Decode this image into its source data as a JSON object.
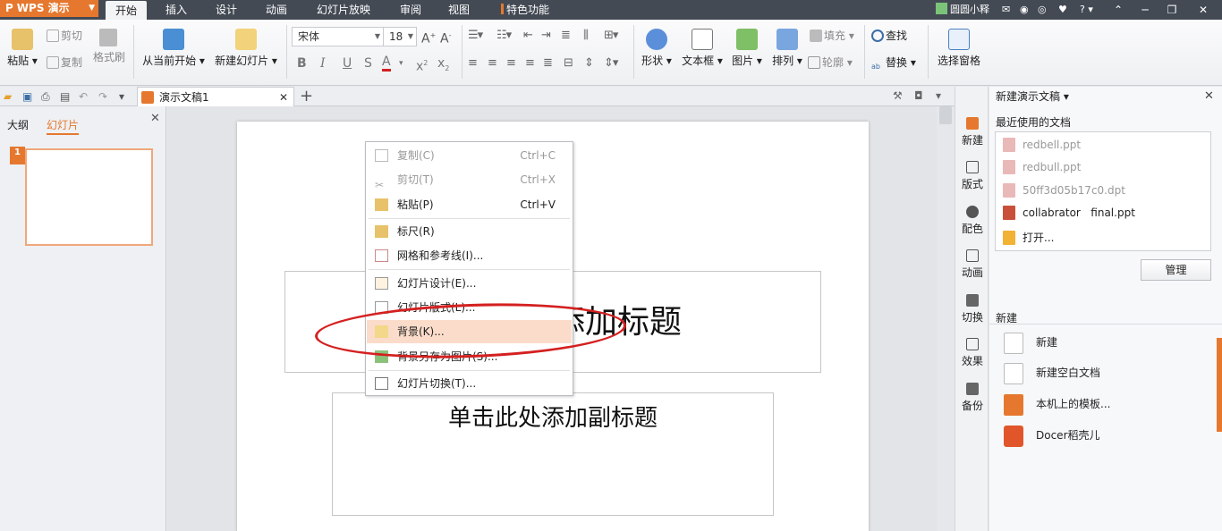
{
  "app": {
    "name": "WPS 演示"
  },
  "menu": {
    "tabs": [
      "开始",
      "插入",
      "设计",
      "动画",
      "幻灯片放映",
      "审阅",
      "视图",
      "特色功能"
    ]
  },
  "user": {
    "name": "圆圆小释",
    "help": "?"
  },
  "ribbon": {
    "paste": "粘贴",
    "cut": "剪切",
    "copy": "复制",
    "format_painter": "格式刷",
    "from_current": "从当前开始",
    "new_slide": "新建幻灯片",
    "font_name": "宋体",
    "font_size": "18",
    "shape": "形状",
    "textbox": "文本框",
    "picture": "图片",
    "arrange": "排列",
    "fill": "填充",
    "outline": "轮廓",
    "find": "查找",
    "replace": "替换",
    "selection_pane": "选择窗格"
  },
  "tabs": {
    "doc_title": "演示文稿1"
  },
  "left_pane": {
    "outline_tab": "大纲",
    "slides_tab": "幻灯片",
    "slide_number": "1"
  },
  "slide": {
    "title_placeholder": "单击此处添加标题",
    "subtitle_placeholder": "单击此处添加副标题"
  },
  "context_menu": {
    "items": [
      {
        "label": "复制(C)",
        "shortcut": "Ctrl+C"
      },
      {
        "label": "剪切(T)",
        "shortcut": "Ctrl+X"
      },
      {
        "label": "粘贴(P)",
        "shortcut": "Ctrl+V"
      },
      {
        "label": "标尺(R)",
        "shortcut": ""
      },
      {
        "label": "网格和参考线(I)...",
        "shortcut": ""
      },
      {
        "label": "幻灯片设计(E)...",
        "shortcut": ""
      },
      {
        "label": "幻灯片版式(L)...",
        "shortcut": ""
      },
      {
        "label": "背景(K)...",
        "shortcut": ""
      },
      {
        "label": "背景另存为图片(S)...",
        "shortcut": ""
      },
      {
        "label": "幻灯片切换(T)...",
        "shortcut": ""
      }
    ]
  },
  "sidebar": {
    "items": [
      "新建",
      "版式",
      "配色",
      "动画",
      "切换",
      "效果",
      "备份"
    ]
  },
  "task_pane": {
    "title": "新建演示文稿",
    "recent_heading": "最近使用的文档",
    "recent_files": [
      "redbell.ppt",
      "redbull.ppt",
      "50ff3d05b17c0.dpt",
      "collabrator   final.ppt"
    ],
    "open": "打开...",
    "manage": "管理",
    "new_heading": "新建",
    "new_items": [
      "新建",
      "新建空白文档",
      "本机上的模板...",
      "Docer稻壳儿"
    ]
  },
  "colors": {
    "accent": "#e5782e",
    "highlight": "#fbdcca",
    "annotation": "#d42020"
  }
}
